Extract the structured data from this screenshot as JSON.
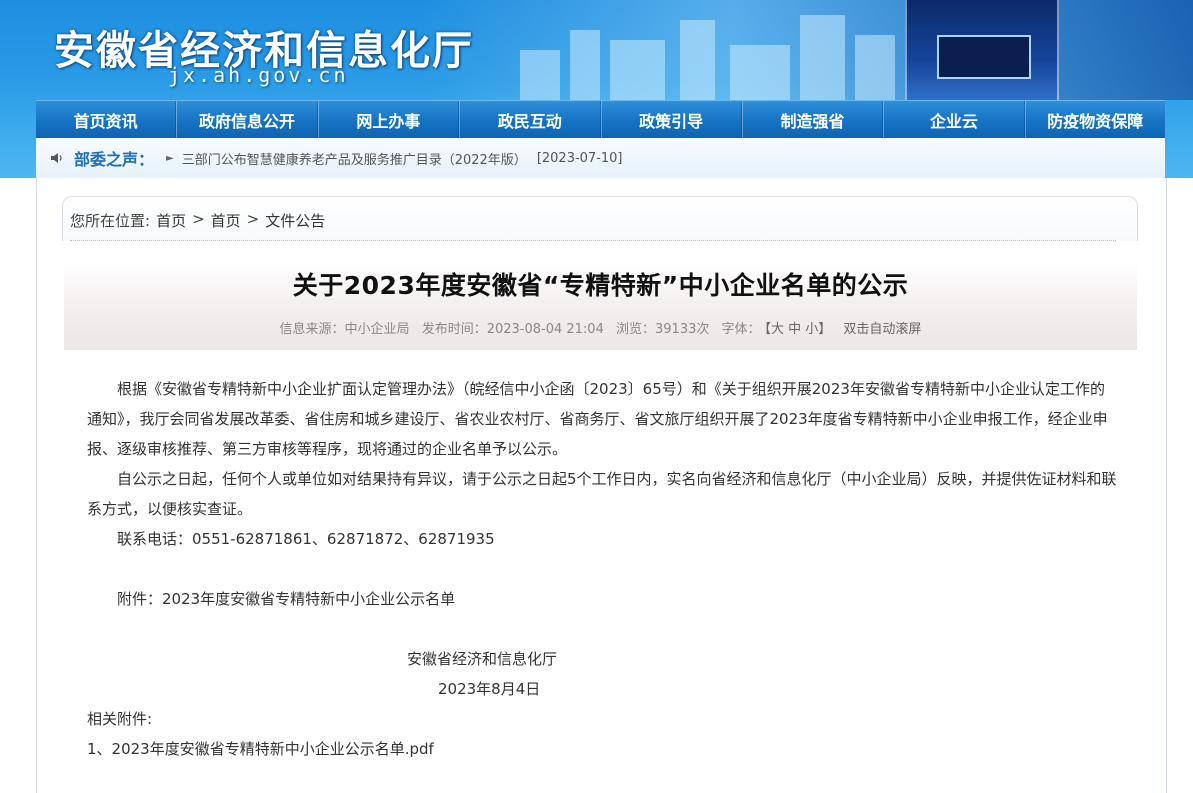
{
  "header": {
    "site_title": "安徽省经济和信息化厅",
    "site_domain": "jx.ah.gov.cn"
  },
  "nav": [
    {
      "label": "首页资讯"
    },
    {
      "label": "政府信息公开"
    },
    {
      "label": "网上办事"
    },
    {
      "label": "政民互动"
    },
    {
      "label": "政策引导"
    },
    {
      "label": "制造强省"
    },
    {
      "label": "企业云"
    },
    {
      "label": "防疫物资保障"
    }
  ],
  "notice": {
    "label": "部委之声：",
    "text": "三部门公布智慧健康养老产品及服务推广目录（2022年版）",
    "date": "[2023-07-10]"
  },
  "breadcrumb": {
    "prefix": "您所在位置:",
    "items": [
      "首页",
      "首页",
      "文件公告"
    ],
    "separator": ">"
  },
  "article": {
    "title": "关于2023年度安徽省“专精特新”中小企业名单的公示",
    "meta": {
      "source": "信息来源：中小企业局",
      "published": "发布时间：2023-08-04 21:04",
      "views": "浏览：39133次",
      "font_label": "字体：",
      "font_sizes": "【大 中 小】",
      "scroll": "双击自动滚屏"
    },
    "paragraphs": [
      "根据《安徽省专精特新中小企业扩面认定管理办法》（皖经信中小企函〔2023〕65号）和《关于组织开展2023年安徽省专精特新中小企业认定工作的通知》，我厅会同省发展改革委、省住房和城乡建设厅、省农业农村厅、省商务厅、省文旅厅组织开展了2023年度省专精特新中小企业申报工作，经企业申报、逐级审核推荐、第三方审核等程序，现将通过的企业名单予以公示。",
      "自公示之日起，任何个人或单位如对结果持有异议，请于公示之日起5个工作日内，实名向省经济和信息化厅（中小企业局）反映，并提供佐证材料和联系方式，以便核实查证。",
      "联系电话：0551-62871861、62871872、62871935"
    ],
    "attachment_line": "附件：2023年度安徽省专精特新中小企业公示名单",
    "signature": "安徽省经济和信息化厅",
    "date": "2023年8月4日",
    "related_label": "相关附件:",
    "related_files": [
      "1、2023年度安徽省专精特新中小企业公示名单.pdf"
    ]
  }
}
